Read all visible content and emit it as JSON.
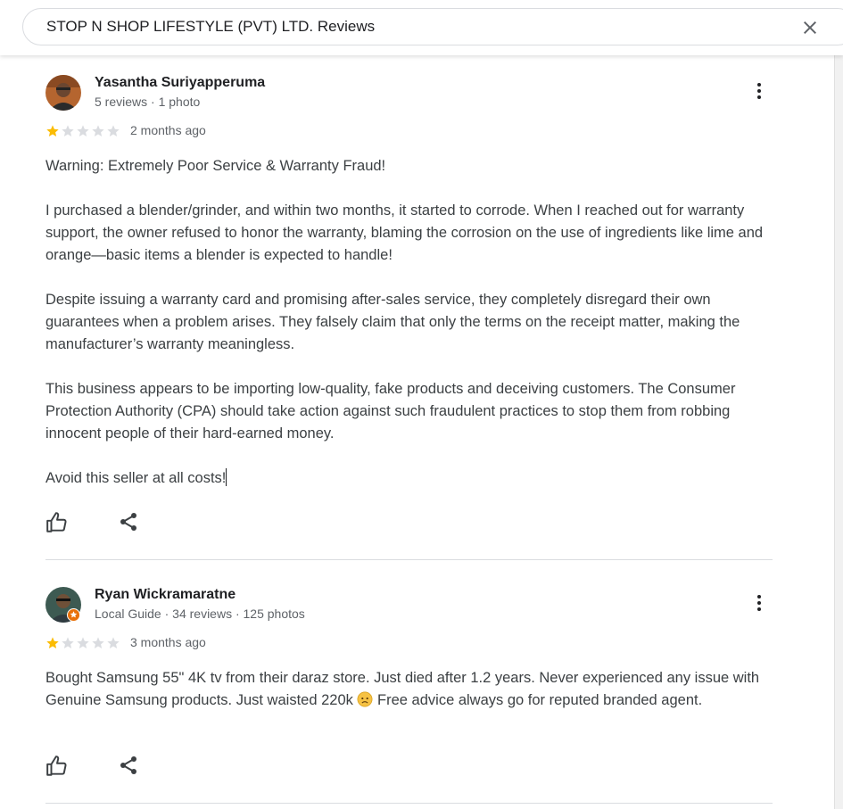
{
  "search": {
    "query": "STOP N SHOP LIFESTYLE (PVT) LTD. Reviews"
  },
  "colors": {
    "star_filled": "#fbbc04",
    "star_empty": "#dadce0",
    "text": "#3c4043",
    "meta": "#5f6368"
  },
  "reviews": [
    {
      "name": "Yasantha Suriyapperuma",
      "meta": "5 reviews · 1 photo",
      "rating": 1,
      "date": "2 months ago",
      "paragraphs": [
        "Warning: Extremely Poor Service & Warranty Fraud!",
        "I purchased a blender/grinder, and within two months, it started to corrode. When I reached out for warranty support, the owner refused to honor the warranty, blaming the corrosion on the use of ingredients like lime and orange—basic items a blender is expected to handle!",
        "Despite issuing a warranty card and promising after-sales service, they completely disregard their own guarantees when a problem arises. They falsely claim that only the terms on the receipt matter, making the manufacturer’s warranty meaningless.",
        "This business appears to be importing low-quality, fake products and deceiving customers. The Consumer Protection Authority (CPA) should take action against such fraudulent practices to stop them from robbing innocent people of their hard-earned money.",
        "Avoid this seller at all costs!"
      ]
    },
    {
      "name": "Ryan Wickramaratne",
      "meta": "Local Guide · 34 reviews · 125 photos",
      "rating": 1,
      "date": "3 months ago",
      "text_before_emoji": "Bought Samsung 55\" 4K tv from their daraz store. Just died after 1.2 years. Never experienced any issue with Genuine Samsung products. Just waisted 220k ",
      "emoji": "disappointed-face",
      "text_after_emoji": " Free advice always go for reputed branded agent."
    }
  ]
}
